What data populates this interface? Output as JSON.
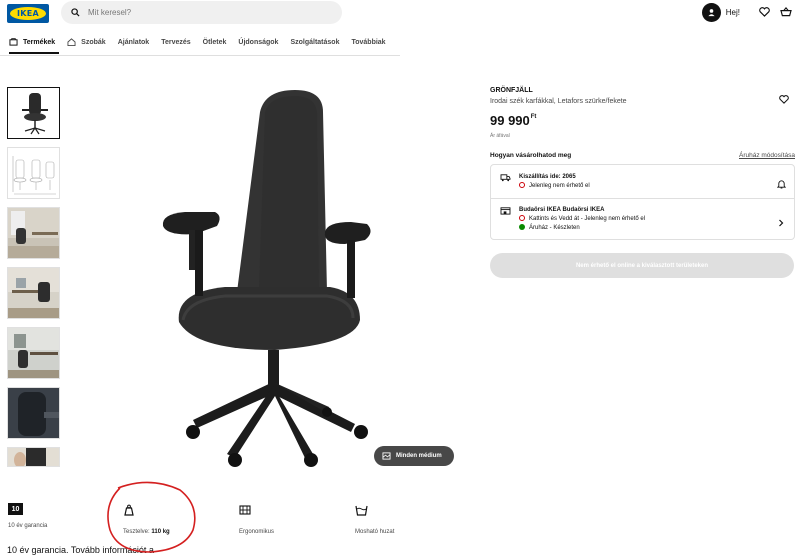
{
  "header": {
    "logo_text": "IKEA",
    "search_placeholder": "Mit keresel?",
    "greeting": "Hej!",
    "icons": [
      "user-icon",
      "heart-icon",
      "cart-icon"
    ]
  },
  "nav": {
    "items": [
      {
        "label": "Termékek",
        "icon": "catalog-icon",
        "active": true
      },
      {
        "label": "Szobák",
        "icon": "home-icon"
      },
      {
        "label": "Ajánlatok"
      },
      {
        "label": "Tervezés"
      },
      {
        "label": "Ötletek"
      },
      {
        "label": "Újdonságok"
      },
      {
        "label": "Szolgáltatások"
      },
      {
        "label": "Továbbiak"
      }
    ]
  },
  "media": {
    "thumbnail_count": 7,
    "all_media_label": "Minden médium"
  },
  "features": [
    {
      "badge": "10",
      "label": "10 év garancia"
    },
    {
      "icon": "weight-icon",
      "label_prefix": "Tesztelve: ",
      "label_value": "110 kg"
    },
    {
      "icon": "ergonomic-icon",
      "label": "Ergonomikus"
    },
    {
      "icon": "washable-icon",
      "label": "Mosható huzat"
    }
  ],
  "guarantee_text": "10 év garancia. Tovább információt a",
  "product": {
    "name": "GRÖNFJÄLL",
    "description": "Irodai szék karfákkal, Letafors szürke/fekete",
    "price": "99 990",
    "currency": "Ft",
    "vat_note": "Ár áfával",
    "how_to_buy": "Hogyan vásárolhatod meg",
    "change_store": "Áruház módosítása",
    "delivery": {
      "title": "Kiszállítás ide: 2065",
      "status": "Jelenleg nem érhető el"
    },
    "store": {
      "title": "Budaörsi IKEA Budaörsi IKEA",
      "click_collect": "Kattints és Vedd át - Jelenleg nem érhető el",
      "stock": "Áruház - Készleten"
    },
    "cta": "Nem érhető el online a kiválasztott területeken"
  },
  "colors": {
    "ikea_blue": "#0058a3",
    "ikea_yellow": "#ffdb00",
    "unavailable_red": "#cc0008",
    "in_stock_green": "#0a8a00",
    "annotation_red": "#d42020"
  }
}
